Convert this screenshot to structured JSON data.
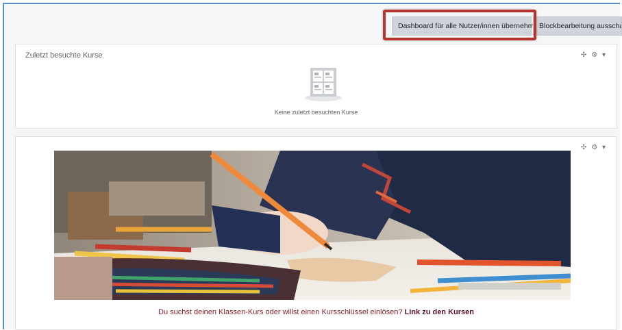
{
  "topbar": {
    "reset_dashboard_label": "Dashboard für alle Nutzer/innen übernehmen",
    "stop_editing_label": "Blockbearbeitung ausschalten"
  },
  "recent_courses_block": {
    "title": "Zuletzt besuchte Kurse",
    "empty_text": "Keine zuletzt besuchten Kurse",
    "controls": [
      "move-icon",
      "gear-icon",
      "caret-down-icon"
    ]
  },
  "image_block": {
    "controls": [
      "move-icon",
      "gear-icon",
      "caret-down-icon"
    ],
    "image_description": "child-drawing-with-colored-pencils",
    "caption_text": "Du suchst deinen Klassen-Kurs oder willst einen Kursschlüssel einlösen?",
    "caption_link": "Link zu den Kursen"
  },
  "colors": {
    "highlight_border": "#b5362f",
    "caption_text": "#8b2230",
    "caption_link": "#5b1225",
    "button_bg": "#ced4da",
    "frame_border": "#5b8ec9"
  }
}
